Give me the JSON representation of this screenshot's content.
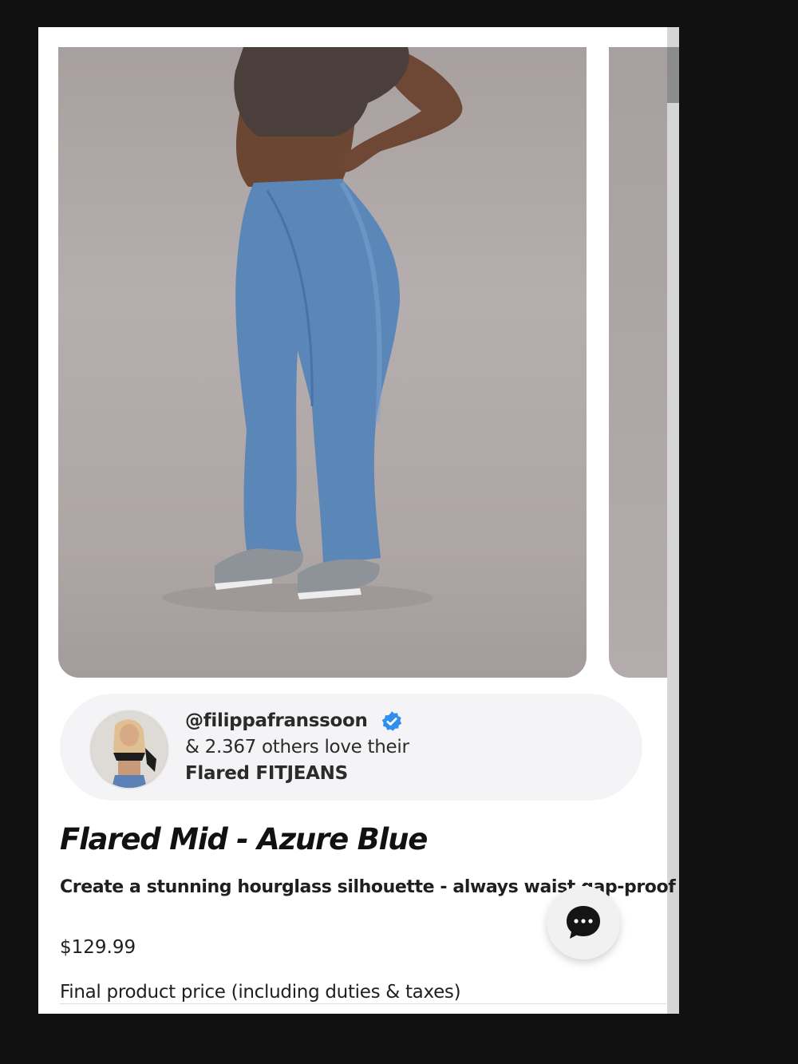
{
  "product": {
    "title": "Flared Mid - Azure Blue",
    "subtitle": "Create a stunning hourglass silhouette - always waist gap-proof",
    "price": "$129.99",
    "price_note": "Final product price (including duties & taxes)"
  },
  "social_proof": {
    "handle": "@filippafranssoon",
    "line2": "& 2.367 others love their",
    "line3": "Flared FITJEANS",
    "verified_icon": "verified-badge-icon",
    "verified_color": "#2f8ef0"
  },
  "chat": {
    "icon": "chat-bubble-icon",
    "color": "#151515"
  }
}
